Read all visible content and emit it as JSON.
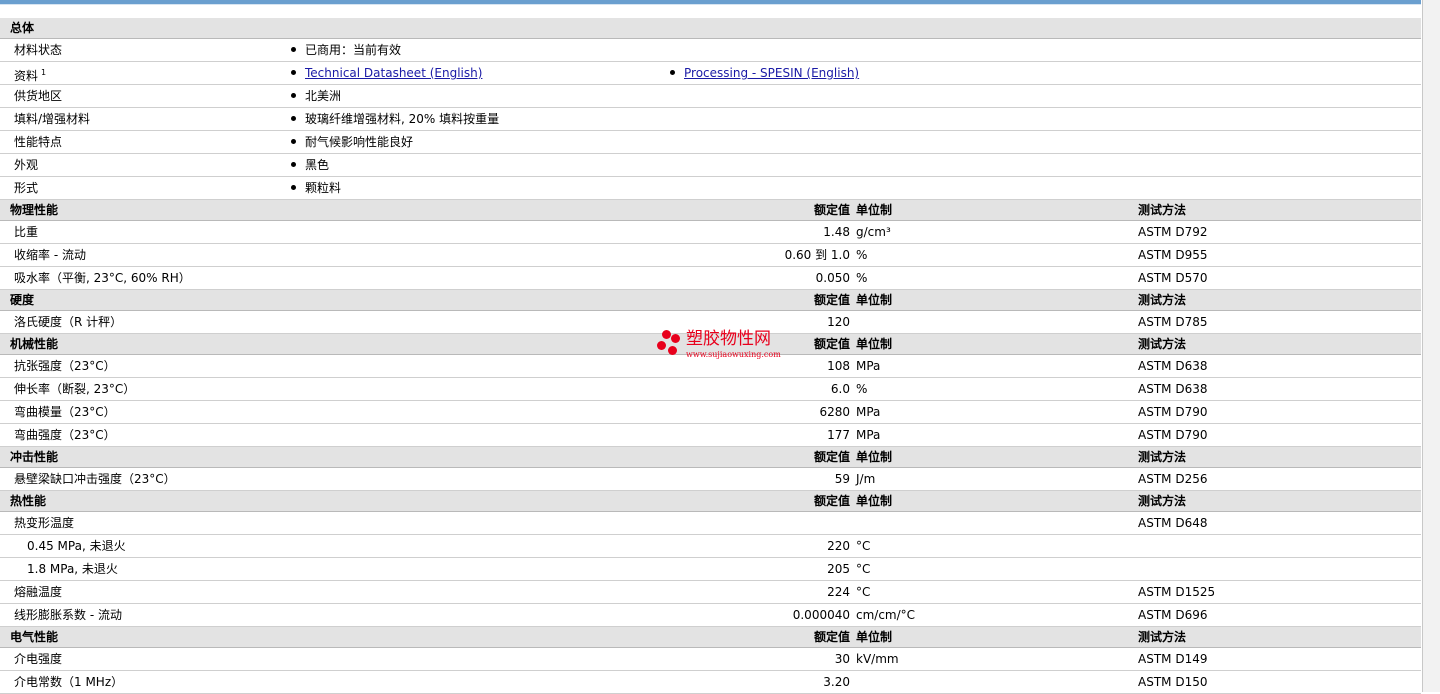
{
  "general": {
    "header": "总体",
    "rows": [
      {
        "label": "材料状态",
        "bullets": [
          "已商用：当前有效"
        ]
      },
      {
        "label": "资料",
        "sup": "1",
        "bullets": [],
        "links": [
          "Technical Datasheet (English)",
          "Processing - SPESIN (English)"
        ]
      },
      {
        "label": "供货地区",
        "bullets": [
          "北美洲"
        ]
      },
      {
        "label": "填料/增强材料",
        "bullets": [
          "玻璃纤维增强材料, 20% 填料按重量"
        ]
      },
      {
        "label": "性能特点",
        "bullets": [
          "耐气候影响性能良好"
        ]
      },
      {
        "label": "外观",
        "bullets": [
          "黑色"
        ]
      },
      {
        "label": "形式",
        "bullets": [
          "颗粒料"
        ]
      }
    ]
  },
  "column_headers": {
    "value": "额定值",
    "unit": "单位制",
    "test": "测试方法"
  },
  "sections": [
    {
      "title": "物理性能",
      "rows": [
        {
          "name": "比重",
          "value": "1.48",
          "unit": "g/cm³",
          "test": "ASTM D792"
        },
        {
          "name": "收缩率 - 流动",
          "value": "0.60 到  1.0",
          "unit": "%",
          "test": "ASTM D955"
        },
        {
          "name": "吸水率（平衡, 23°C, 60% RH）",
          "value": "0.050",
          "unit": "%",
          "test": "ASTM D570"
        }
      ]
    },
    {
      "title": "硬度",
      "rows": [
        {
          "name": "洛氏硬度（R 计秤）",
          "value": "120",
          "unit": "",
          "test": "ASTM D785"
        }
      ]
    },
    {
      "title": "机械性能",
      "rows": [
        {
          "name": "抗张强度（23°C）",
          "value": "108",
          "unit": "MPa",
          "test": "ASTM D638"
        },
        {
          "name": "伸长率（断裂, 23°C）",
          "value": "6.0",
          "unit": "%",
          "test": "ASTM D638"
        },
        {
          "name": "弯曲模量（23°C）",
          "value": "6280",
          "unit": "MPa",
          "test": "ASTM D790"
        },
        {
          "name": "弯曲强度（23°C）",
          "value": "177",
          "unit": "MPa",
          "test": "ASTM D790"
        }
      ]
    },
    {
      "title": "冲击性能",
      "rows": [
        {
          "name": "悬壁梁缺口冲击强度（23°C）",
          "value": "59",
          "unit": "J/m",
          "test": "ASTM D256"
        }
      ]
    },
    {
      "title": "热性能",
      "rows": [
        {
          "name": "热变形温度",
          "value": "",
          "unit": "",
          "test": "ASTM D648"
        },
        {
          "name": "0.45 MPa, 未退火",
          "value": "220",
          "unit": "°C",
          "test": "",
          "sub": true
        },
        {
          "name": "1.8 MPa, 未退火",
          "value": "205",
          "unit": "°C",
          "test": "",
          "sub": true
        },
        {
          "name": "熔融温度",
          "value": "224",
          "unit": "°C",
          "test": "ASTM D1525"
        },
        {
          "name": "线形膨胀系数 - 流动",
          "value": "0.000040",
          "unit": "cm/cm/°C",
          "test": "ASTM D696"
        }
      ]
    },
    {
      "title": "电气性能",
      "rows": [
        {
          "name": "介电强度",
          "value": "30",
          "unit": "kV/mm",
          "test": "ASTM D149"
        },
        {
          "name": "介电常数（1 MHz）",
          "value": "3.20",
          "unit": "",
          "test": "ASTM D150"
        }
      ]
    }
  ],
  "watermark": {
    "brand": "塑胶物性网",
    "url": "www.sujiaowuxing.com",
    "color": "#e8001c"
  }
}
